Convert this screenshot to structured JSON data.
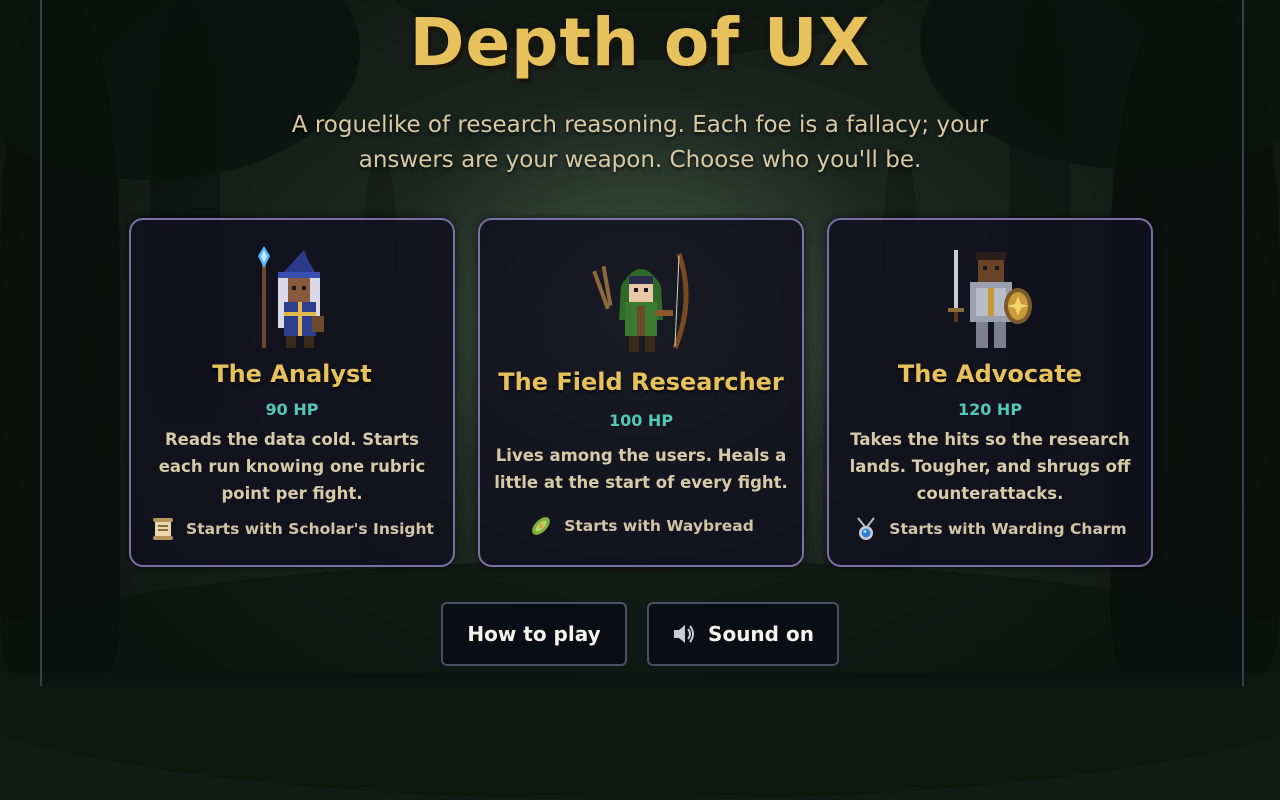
{
  "title": "Depth of UX",
  "subtitle": "A roguelike of research reasoning. Each foe is a fallacy; your answers are your weapon. Choose who you'll be.",
  "characters": [
    {
      "name": "The Analyst",
      "hp": "90 HP",
      "description": "Reads the data cold. Starts each run knowing one rubric point per fight.",
      "perk": "Starts with Scholar's Insight",
      "portrait_icon": "wizard-portrait-icon",
      "perk_icon": "scroll-icon"
    },
    {
      "name": "The Field Researcher",
      "hp": "100 HP",
      "description": "Lives among the users. Heals a little at the start of every fight.",
      "perk": "Starts with Waybread",
      "portrait_icon": "ranger-portrait-icon",
      "perk_icon": "waybread-icon"
    },
    {
      "name": "The Advocate",
      "hp": "120 HP",
      "description": "Takes the hits so the research lands. Tougher, and shrugs off counterattacks.",
      "perk": "Starts with Warding Charm",
      "portrait_icon": "knight-portrait-icon",
      "perk_icon": "amulet-icon"
    }
  ],
  "buttons": {
    "how_to_play": "How to play",
    "sound": "Sound on",
    "sound_icon": "speaker-icon"
  },
  "colors": {
    "title": "#e7c15b",
    "hp": "#54c7b4",
    "card_border": "#7c6fa6",
    "card_bg": "#12101e"
  }
}
